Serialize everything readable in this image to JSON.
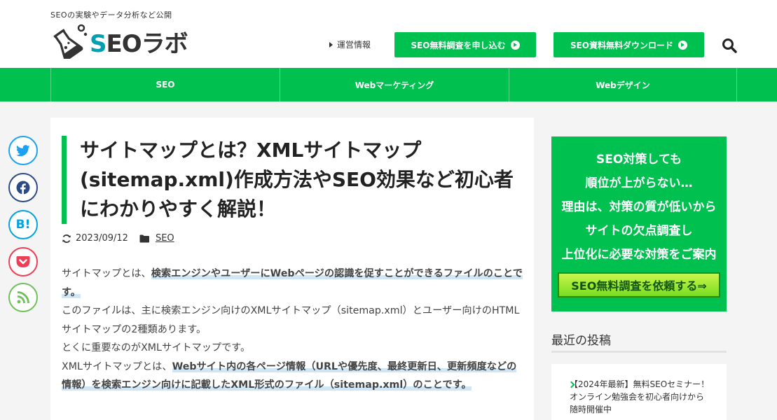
{
  "header": {
    "tagline": "SEOの実験やデータ分析など公開",
    "logo_text_s": "S",
    "logo_text_rest": "EOラボ",
    "nav_link": "運営情報",
    "btn_apply": "SEO無料調査を申し込む",
    "btn_download": "SEO資料無料ダウンロード",
    "search_icon": "search-icon"
  },
  "gnav": {
    "items": [
      {
        "label": "SEO"
      },
      {
        "label": "Webマーケティング"
      },
      {
        "label": "Webデザイン"
      }
    ]
  },
  "share": {
    "items": [
      {
        "name": "twitter-icon",
        "color": "#1da1f2"
      },
      {
        "name": "facebook-icon",
        "color": "#2c4a86"
      },
      {
        "name": "hatena-bookmark-icon",
        "color": "#00a4de",
        "text": "B!"
      },
      {
        "name": "pocket-icon",
        "color": "#ef3f56"
      },
      {
        "name": "rss-icon",
        "color": "#6fc05a"
      }
    ]
  },
  "article": {
    "title": "サイトマップとは？XMLサイトマップ(sitemap.xml)作成方法やSEO効果など初心者にわかりやすく解説！",
    "date": "2023/09/12",
    "category": "SEO",
    "p1_a": "サイトマップとは、",
    "p1_hl": "検索エンジンやユーザーにWebページの認識を促すことができるファイルのことです。",
    "p2": "このファイルは、主に検索エンジン向けのXMLサイトマップ（sitemap.xml）とユーザー向けのHTMLサイトマップの2種類あります。",
    "p3": "とくに重要なのがXMLサイトマップです。",
    "p4_a": "XMLサイトマップとは、",
    "p4_hl": "Webサイト内の各ページ情報（URLや優先度、最終更新日、更新頻度などの情報）を検索エンジン向けに記載したXML形式のファイル（sitemap.xml）のことです。"
  },
  "sidebar": {
    "banner_lines": [
      "SEO対策しても",
      "順位が上がらない…",
      "理由は、対策の質が低いから",
      "サイトの欠点調査し",
      "上位化に必要な対策をご案内"
    ],
    "banner_button": "SEO無料調査を依頼する⇒",
    "recent_title": "最近の投稿",
    "recent_item": "【2024年最新】無料SEOセミナー！オンライン勉強会を初心者向けから随時開催中"
  },
  "colors": {
    "brand_green": "#00c050",
    "logo_teal": "#00a0b0"
  }
}
